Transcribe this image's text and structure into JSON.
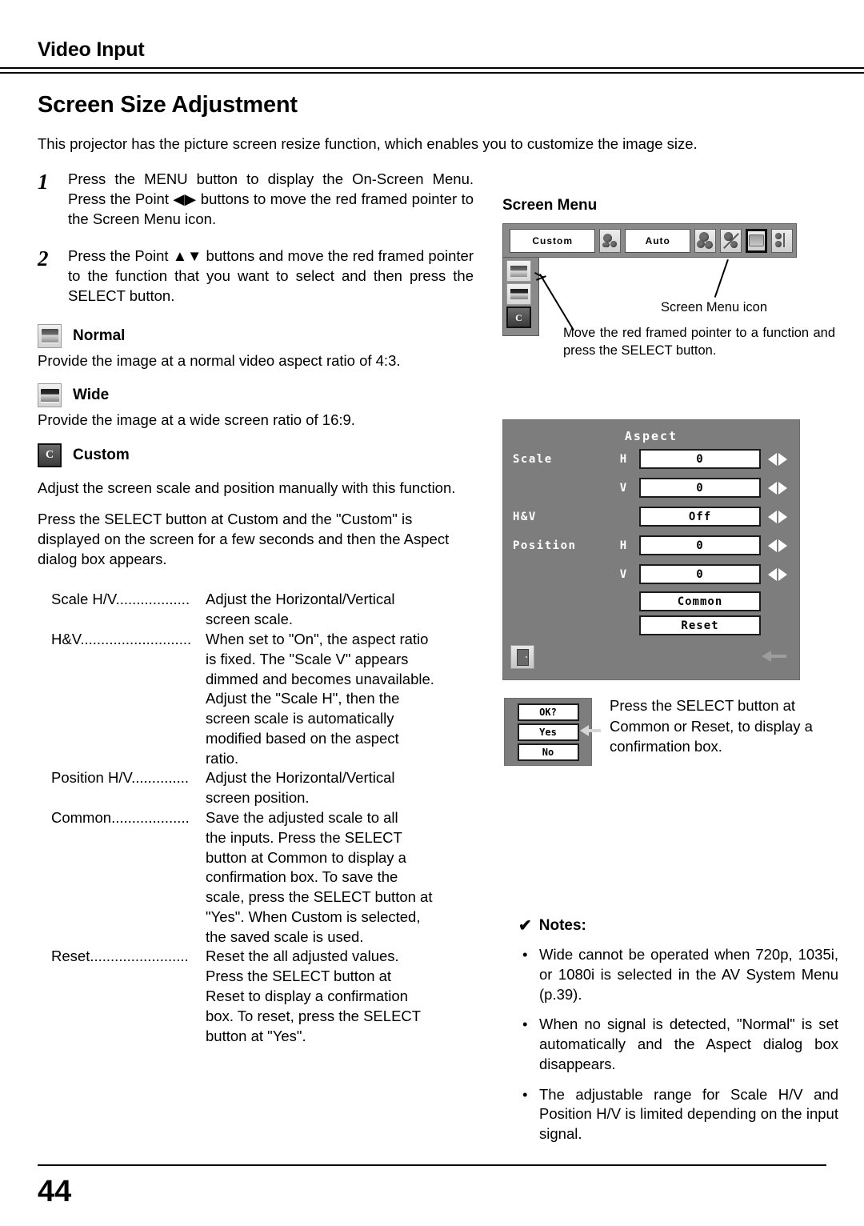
{
  "header": {
    "chapter": "Video Input",
    "title": "Screen Size Adjustment",
    "intro": "This projector has the picture screen resize function, which enables you to customize the image size."
  },
  "steps": [
    {
      "num": "1",
      "text": "Press the MENU button to display the On-Screen Menu.  Press the Point ◀▶ buttons to move the red framed pointer to the Screen Menu icon."
    },
    {
      "num": "2",
      "text": "Press the Point ▲▼ buttons and move the red framed pointer to the function that you want to select and then press the SELECT button."
    }
  ],
  "options": [
    {
      "icon": "normal-screen-icon",
      "label": "Normal",
      "desc": "Provide the image at a normal video aspect ratio of 4:3."
    },
    {
      "icon": "wide-screen-icon",
      "label": "Wide",
      "desc": "Provide the image at a wide screen ratio of 16:9."
    },
    {
      "icon": "custom-screen-icon",
      "label": "Custom",
      "desc": ""
    }
  ],
  "custom_paragraphs": [
    "Adjust the screen scale and position manually with this function.",
    "Press the SELECT button at Custom and the \"Custom\" is displayed on the screen for a few seconds and then the Aspect dialog box appears."
  ],
  "definitions": [
    {
      "term": "Scale H/V",
      "leader": "..................",
      "desc": "Adjust the Horizontal/Vertical",
      "cont": [
        "screen scale."
      ]
    },
    {
      "term": "H&V",
      "leader": "...........................",
      "desc": "When set to \"On\", the aspect ratio",
      "cont": [
        "is fixed. The \"Scale V\" appears",
        "dimmed and becomes unavailable.",
        "Adjust the \"Scale H\", then the",
        "screen scale is automatically",
        "modified based on the aspect",
        "ratio."
      ]
    },
    {
      "term": "Position H/V",
      "leader": "..............",
      "desc": "Adjust the Horizontal/Vertical",
      "cont": [
        "screen position."
      ]
    },
    {
      "term": "Common",
      "leader": "...................",
      "desc": "Save the adjusted scale to all",
      "cont": [
        "the inputs. Press the SELECT",
        "button at Common to display a",
        "confirmation box. To save the",
        "scale, press the SELECT button at",
        "\"Yes\". When Custom is selected,",
        "the saved scale is used."
      ]
    },
    {
      "term": "Reset",
      "leader": "........................",
      "desc": "Reset the all adjusted values.",
      "cont": [
        "Press the SELECT button at",
        "Reset to display a confirmation",
        "box. To reset, press the SELECT",
        "button at \"Yes\"."
      ]
    }
  ],
  "screen_menu": {
    "title": "Screen Menu",
    "bar": {
      "custom_field": "Custom",
      "auto_field": "Auto",
      "icons": [
        "input-source-icon",
        "color-adjust-icon",
        "image-adjust-icon",
        "screen-menu-icon",
        "sound-icon"
      ]
    },
    "submenu_icons": [
      "normal-screen-icon",
      "wide-screen-icon",
      "custom-screen-icon"
    ],
    "callout_icon": "Screen Menu icon",
    "callout_move": "Move the red framed pointer to a function and press the SELECT button."
  },
  "aspect_dialog": {
    "title": "Aspect",
    "rows": [
      {
        "label": "Scale",
        "hv": "H",
        "value": "0",
        "arrows": true
      },
      {
        "label": "",
        "hv": "V",
        "value": "0",
        "arrows": true
      },
      {
        "label": "H&V",
        "hv": "",
        "value": "Off",
        "arrows": true
      },
      {
        "label": "Position",
        "hv": "H",
        "value": "0",
        "arrows": true
      },
      {
        "label": "",
        "hv": "V",
        "value": "0",
        "arrows": true
      }
    ],
    "buttons": [
      "Common",
      "Reset"
    ],
    "exit_icon": "exit-door-icon",
    "back_icon": "back-arrow-icon"
  },
  "confirm_box": {
    "buttons": [
      "OK?",
      "Yes",
      "No"
    ],
    "pointer_icon": "left-arrow-pointer-icon",
    "caption": "Press the SELECT button at Common or Reset, to display a confirmation box."
  },
  "notes": {
    "check_icon": "✔",
    "heading": "Notes:",
    "bullet": "•",
    "items": [
      "Wide cannot be operated when 720p, 1035i, or 1080i is selected in the AV System Menu (p.39).",
      "When no signal is detected, \"Normal\" is set automatically and the Aspect dialog box disappears.",
      "The adjustable range for Scale H/V and Position H/V is limited depending on the input signal."
    ]
  },
  "footer": {
    "page_number": "44"
  }
}
